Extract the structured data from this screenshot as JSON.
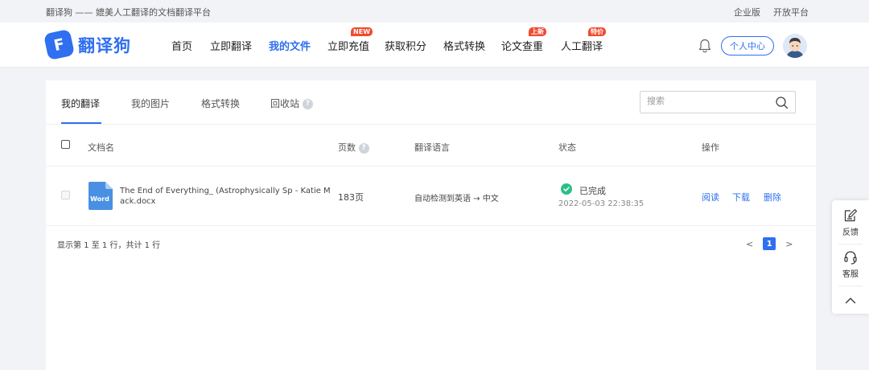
{
  "topbar": {
    "tagline": "翻译狗 —— 媲美人工翻译的文档翻译平台",
    "links": [
      "企业版",
      "开放平台"
    ]
  },
  "header": {
    "logo_mark": "F",
    "logo_text": "翻译狗",
    "nav": [
      {
        "label": "首页",
        "badge": ""
      },
      {
        "label": "立即翻译",
        "badge": ""
      },
      {
        "label": "我的文件",
        "badge": "",
        "active": true
      },
      {
        "label": "立即充值",
        "badge": "NEW"
      },
      {
        "label": "获取积分",
        "badge": ""
      },
      {
        "label": "格式转换",
        "badge": ""
      },
      {
        "label": "论文查重",
        "badge": "上新"
      },
      {
        "label": "人工翻译",
        "badge": "特价"
      }
    ],
    "center_button": "个人中心",
    "accent_color": "#2f6ff0",
    "badge_color": "#f24a2f"
  },
  "tabs": [
    {
      "label": "我的翻译",
      "active": true
    },
    {
      "label": "我的图片"
    },
    {
      "label": "格式转换"
    },
    {
      "label": "回收站"
    }
  ],
  "search": {
    "placeholder": "搜索",
    "value": ""
  },
  "table": {
    "columns": [
      "文档名",
      "页数",
      "翻译语言",
      "状态",
      "操作"
    ],
    "rows": [
      {
        "file_icon": "Word",
        "name": "The End of Everything_ (Astrophysically Sp - Katie Mack.docx",
        "pages": "183页",
        "language": "自动检测到英语 → 中文",
        "status": "已完成",
        "time": "2022-05-03 22:38:35",
        "actions": [
          "阅读",
          "下载",
          "删除"
        ]
      }
    ]
  },
  "pagination": {
    "info": "显示第 1 至 1 行，共计 1 行",
    "prev": "<",
    "current": "1",
    "next": ">"
  },
  "float_panel": {
    "items": [
      "反馈",
      "客服"
    ],
    "top_icon": "chevron-up-icon"
  }
}
